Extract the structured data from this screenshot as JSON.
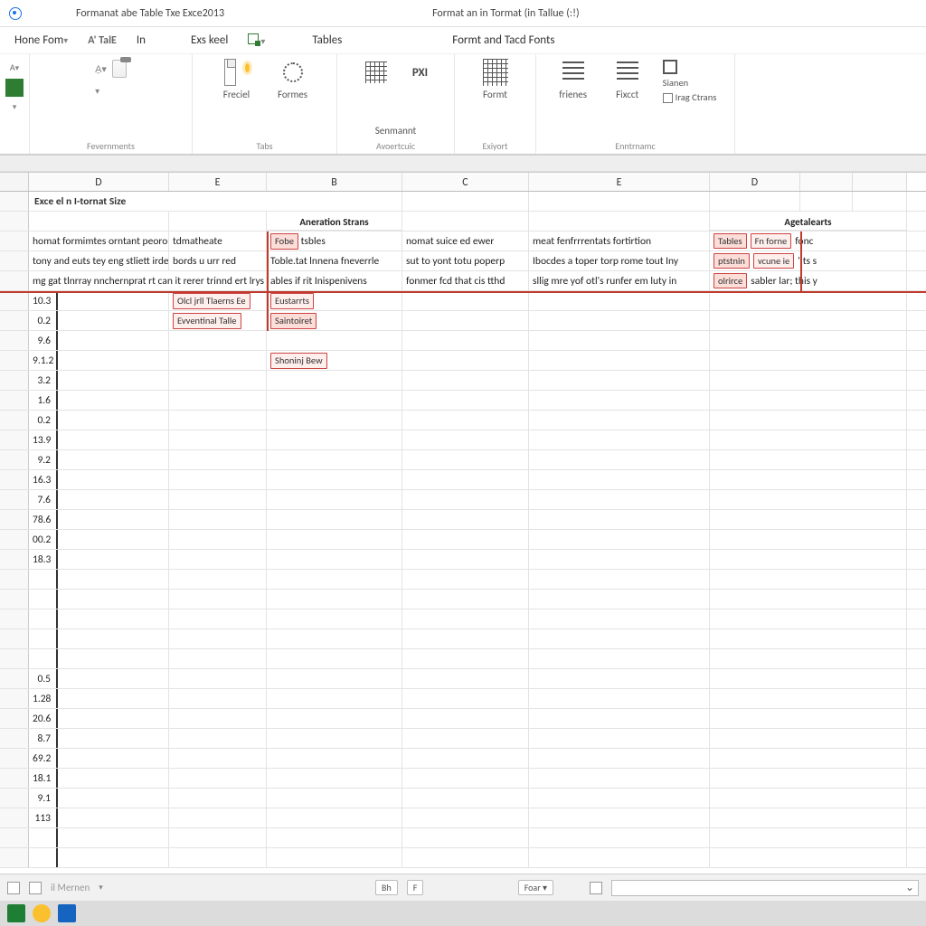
{
  "titlebar": {
    "left": "Formanat abe Table Txe Exce2013",
    "right": "Format an in Tormat (in Tallue (:!)"
  },
  "tabs": {
    "home": "Hone Fom",
    "aa": "A' TalE",
    "in": "In",
    "exskeel": "Exs keel",
    "tables": "Tables",
    "fonts": "Formt and Tacd Fonts"
  },
  "ribbon": {
    "g1_name": "Fevernments",
    "g2_name": "Tabs",
    "g2_t1": "Freciel",
    "g2_t2": "Formes",
    "g3_name": "Avoertcuic",
    "g3_t1": "Senmannt",
    "g4_name": "Exiyort",
    "g4_t1": "Formt",
    "g5_name": "Enntrnamc",
    "g5_r1a": "frienes",
    "g5_r1b": "Fixcct",
    "g5_r1c": "Sianen",
    "g5_r2": "Irag Ctrans"
  },
  "cols": [
    "D",
    "E",
    "B",
    "C",
    "E",
    "D"
  ],
  "section_title": "Exce el n I-tornat Size",
  "subheads": {
    "b": "Aneration Strans",
    "e2": "Agetalearts"
  },
  "row4": {
    "d1": "homat formimtes orntant peorord.",
    "e1": "tdmatheate",
    "b_tag1": "Fobe",
    "b_tag2": "tsbles",
    "c": "nomat suice ed ewer",
    "e2": "meat fenfrrrentats fortirtion",
    "d2_tag1": "Tables",
    "d2_tag2": "Fn forne",
    "d2_tag3": "fonc"
  },
  "row5": {
    "d1": "tony and euts tey eng stliett irdeesernent",
    "e1": "bords u urr red",
    "b": "Toble.tat lnnena fneverrle",
    "c": "sut to yont totu poperp",
    "e2": "Ibocdes a toper torp rome tout Iny",
    "d2_tag1": "ptstnin",
    "d2_tag2": "vcune ie",
    "d2_tag3": "'Its s"
  },
  "row6": {
    "d1": "mg gat tlnrray nnchernprat rt can it rerer trinnd ert lrys",
    "b": "ables if rit Inispenivens",
    "c": "fonmer fcd that cis tthd",
    "e2": "sllig mre yof otl's runfer em luty in",
    "d2_tag1": "olrirce",
    "d2_tag2": "sabler lar; this y"
  },
  "e1_tags": {
    "r7": "Olcl jrll Tlaerns Ee",
    "r8": "Evventinal Talle"
  },
  "b_tags": {
    "r7": "Eustarrts",
    "r8": "Saintoiret",
    "r10": "Shoninj Bew"
  },
  "numbers_a": [
    "10.3",
    "0.2",
    "9.6",
    "9.1.2",
    "3.2",
    "1.6",
    "0.2",
    "13.9",
    "9.2",
    "16.3",
    "7.6",
    "78.6",
    "00.2",
    "18.3"
  ],
  "numbers_b": [
    "0.5",
    "1.28",
    "20.6",
    "8.7",
    "69.2",
    "18.1",
    "9.1",
    "113"
  ],
  "status": {
    "left_lbl": "il Mernen",
    "mid1": "Bh",
    "mid2": "F",
    "foar": "Foar"
  }
}
